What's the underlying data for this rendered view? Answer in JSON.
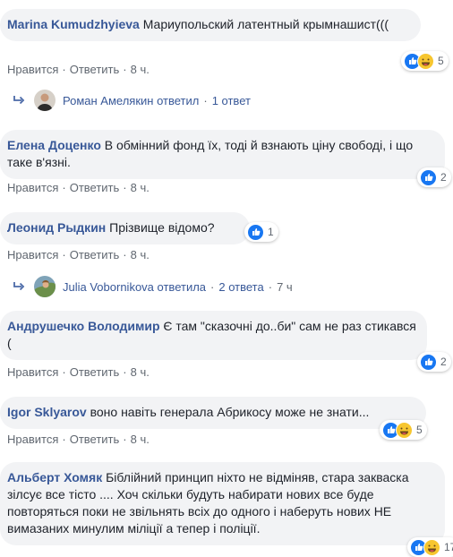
{
  "colors": {
    "bubble": "#f2f3f5",
    "author": "#385898",
    "meta": "#606770",
    "like": "#1877f2",
    "haha": "#f7c62f"
  },
  "actions": {
    "like": "Нравится",
    "reply": "Ответить",
    "sep": "·"
  },
  "comments": [
    {
      "author": "Marina Kumudzhyieva",
      "text": "Мариупольский латентный крымнашист(((",
      "time": "8 ч.",
      "reactions": {
        "icons": [
          "like-icon",
          "haha-icon"
        ],
        "count": "5"
      },
      "replies": {
        "name": "Роман Амелякин",
        "verb": "ответил",
        "count": "1 ответ",
        "time": ""
      }
    },
    {
      "author": "Елена Доценко",
      "text": "В обмінний фонд їх, тоді й взнають ціну свободі, і що таке в'язні.",
      "time": "8 ч.",
      "reactions": {
        "icons": [
          "like-icon"
        ],
        "count": "2"
      }
    },
    {
      "author": "Леонид Рыдкин",
      "text": "Прізвище відомо?",
      "time": "8 ч.",
      "reactions": {
        "icons": [
          "like-icon"
        ],
        "count": "1"
      },
      "replies": {
        "name": "Julia Vobornikova",
        "verb": "ответила",
        "count": "2 ответа",
        "time": "7 ч"
      }
    },
    {
      "author": "Андрушечко Володимир",
      "text": "Є там \"сказочні до..би\" сам не раз стикався (",
      "time": "8 ч.",
      "reactions": {
        "icons": [
          "like-icon"
        ],
        "count": "2"
      }
    },
    {
      "author": "Igor Sklyarov",
      "text": "воно навіть генерала Абрикосу може не знати...",
      "time": "8 ч.",
      "reactions": {
        "icons": [
          "like-icon",
          "haha-icon"
        ],
        "count": "5"
      }
    },
    {
      "author": "Альберт Хомяк",
      "text": "Біблійний принцип ніхто не відміняв, стара закваска зілсує все тісто .... Хоч скільки будуть набирати нових все буде повторяться поки не звільнять всіх до одного і наберуть нових НЕ вимазаних минулим міліції а тепер і поліції.",
      "time": "",
      "reactions": {
        "icons": [
          "like-icon",
          "haha-icon"
        ],
        "count": "17"
      }
    }
  ]
}
